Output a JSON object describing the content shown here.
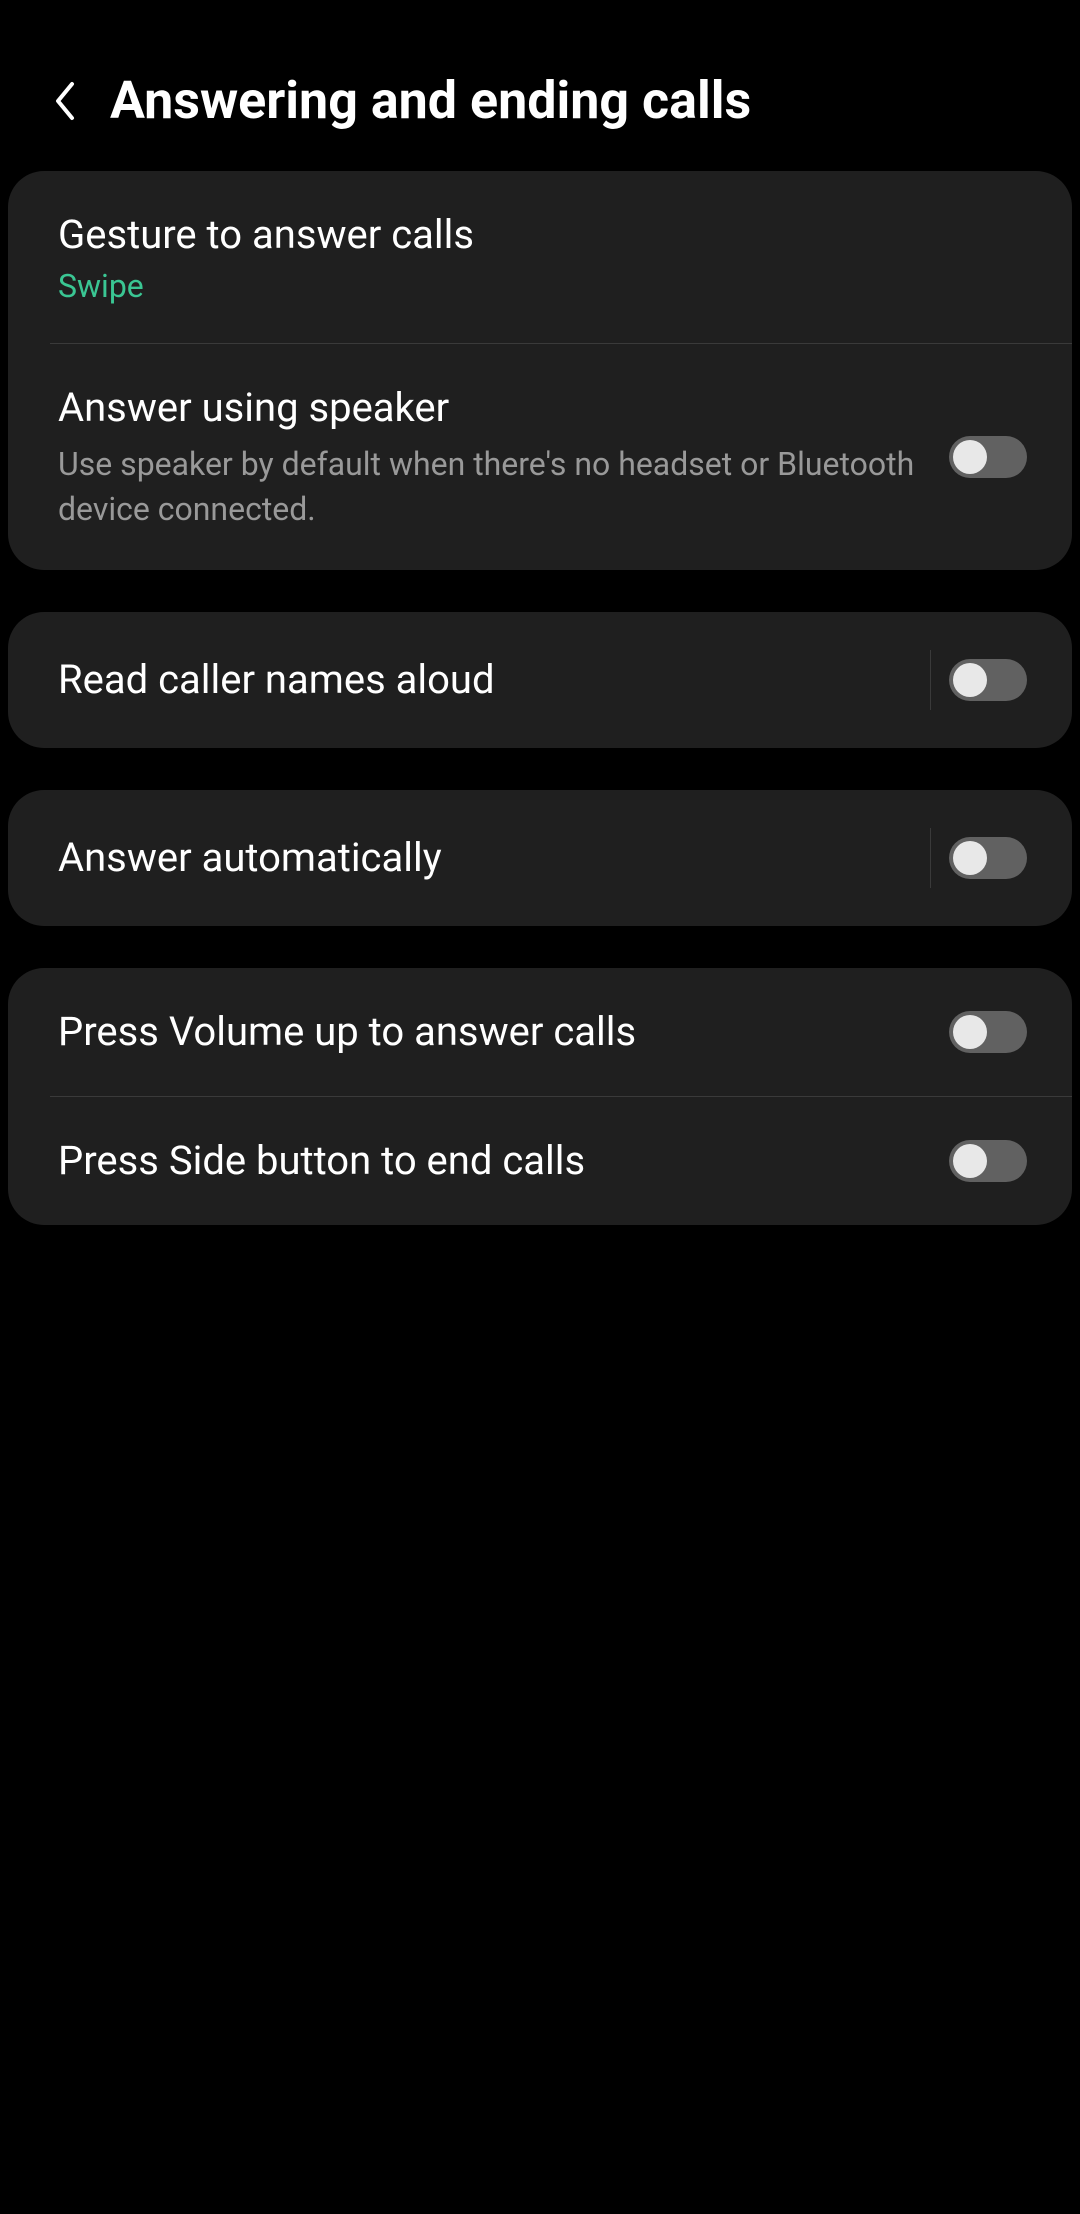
{
  "header": {
    "title": "Answering and ending calls"
  },
  "groups": [
    {
      "items": [
        {
          "title": "Gesture to answer calls",
          "value": "Swipe",
          "hasToggle": false
        },
        {
          "title": "Answer using speaker",
          "description": "Use speaker by default when there's no headset or Bluetooth device connected.",
          "hasToggle": true,
          "toggleOn": false,
          "hasVerticalDivider": false
        }
      ]
    },
    {
      "items": [
        {
          "title": "Read caller names aloud",
          "hasToggle": true,
          "toggleOn": false,
          "hasVerticalDivider": true
        }
      ]
    },
    {
      "items": [
        {
          "title": "Answer automatically",
          "hasToggle": true,
          "toggleOn": false,
          "hasVerticalDivider": true
        }
      ]
    },
    {
      "items": [
        {
          "title": "Press Volume up to answer calls",
          "hasToggle": true,
          "toggleOn": false,
          "hasVerticalDivider": false
        },
        {
          "title": "Press Side button to end calls",
          "hasToggle": true,
          "toggleOn": false,
          "hasVerticalDivider": false
        }
      ]
    }
  ]
}
